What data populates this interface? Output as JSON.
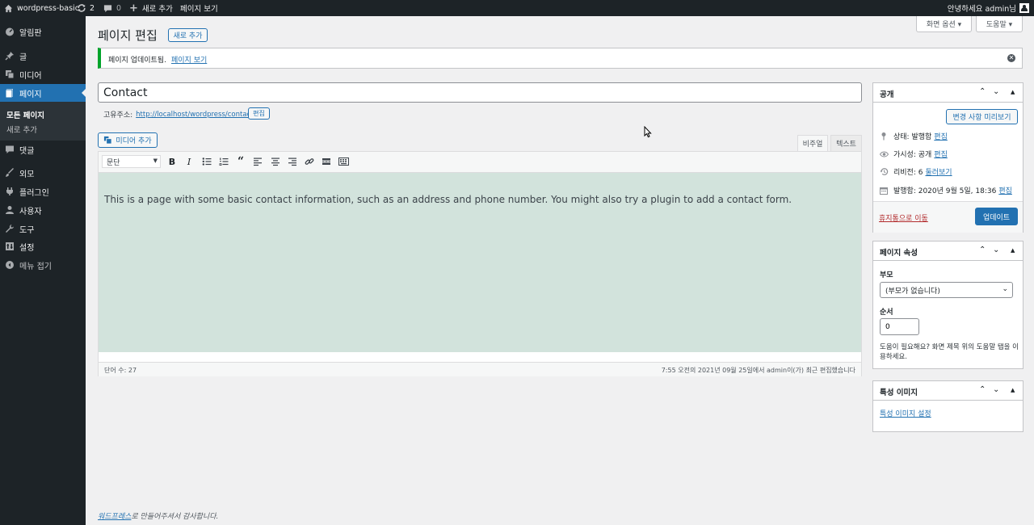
{
  "adminbar": {
    "site": "wordpress-basic",
    "updates": "2",
    "comments": "0",
    "new": "새로 추가",
    "view_page": "페이지 보기",
    "greeting": "안녕하세요 admin님"
  },
  "sidebar": {
    "items": [
      {
        "label": "알림판",
        "icon": "dashboard-icon"
      },
      {
        "label": "글",
        "icon": "pin-icon"
      },
      {
        "label": "미디어",
        "icon": "media-icon"
      },
      {
        "label": "페이지",
        "icon": "page-icon"
      },
      {
        "label": "댓글",
        "icon": "comment-icon"
      },
      {
        "label": "외모",
        "icon": "brush-icon"
      },
      {
        "label": "플러그인",
        "icon": "plugin-icon"
      },
      {
        "label": "사용자",
        "icon": "user-icon"
      },
      {
        "label": "도구",
        "icon": "wrench-icon"
      },
      {
        "label": "설정",
        "icon": "settings-icon"
      },
      {
        "label": "메뉴 접기",
        "icon": "collapse-icon"
      }
    ],
    "submenu": [
      "모든 페이지",
      "새로 추가"
    ]
  },
  "screen_options": "화면 옵션 ▾",
  "help": "도움말 ▾",
  "header": {
    "title": "페이지 편집",
    "add_new": "새로 추가"
  },
  "notice": {
    "text": "페이지 업데이트됨.",
    "link": "페이지 보기"
  },
  "post": {
    "title": "Contact",
    "permalink_label": "고유주소:",
    "permalink_url": "http://localhost/wordpress/contact/",
    "permalink_edit": "편집"
  },
  "editor": {
    "add_media": "미디어 추가",
    "tab_visual": "비주얼",
    "tab_text": "텍스트",
    "format": "문단",
    "content": "This is a page with some basic contact information, such as an address and phone number. You might also try a plugin to add a contact form.",
    "word_count": "단어 수: 27",
    "last_edited": "7:55 오전의 2021년 09월 25일에서 admin이(가) 최근 편집했습니다"
  },
  "publish": {
    "title": "공개",
    "preview": "변경 사항 미리보기",
    "status_label": "상태: 발행함",
    "visibility_label": "가시성: 공개",
    "revisions_label": "리비전: 6",
    "revisions_link": "둘러보기",
    "published_label": "발행함: 2020년 9월 5일, 18:36",
    "edit": "편집",
    "trash": "휴지통으로 이동",
    "update": "업데이트"
  },
  "page_attributes": {
    "title": "페이지 속성",
    "parent_label": "부모",
    "parent_value": "(부모가 없습니다)",
    "order_label": "순서",
    "order_value": "0",
    "help": "도움이 필요해요? 화면 제목 위의 도움말 탭을 이용하세요."
  },
  "featured_image": {
    "title": "특성 이미지",
    "link": "특성 이미지 설정"
  },
  "footer": {
    "link": "워드프레스",
    "text": "로 만들어주셔서 감사합니다."
  },
  "colors": {
    "accent": "#2271b1",
    "sidebar": "#1d2327",
    "editor_bg": "#d2e3dc",
    "notice": "#00a32a"
  }
}
